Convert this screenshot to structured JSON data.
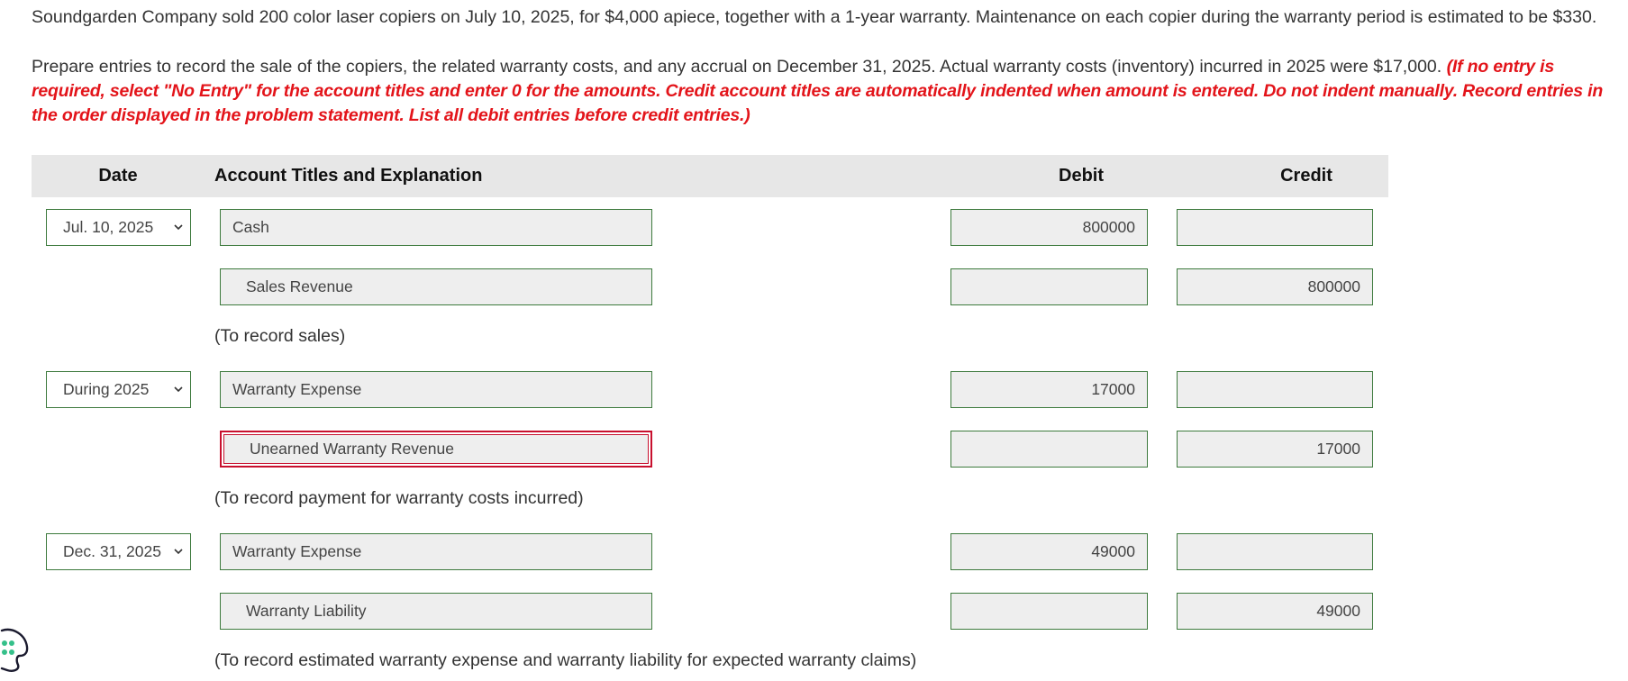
{
  "problem": {
    "paragraph1": "Soundgarden Company sold 200 color laser copiers on July 10, 2025, for $4,000 apiece, together with a 1-year warranty. Maintenance on each copier during the warranty period is estimated to be $330.",
    "paragraph2": "Prepare entries to record the sale of the copiers, the related warranty costs, and any accrual on December 31, 2025. Actual warranty costs (inventory) incurred in 2025 were $17,000.",
    "instructions": "(If no entry is required, select \"No Entry\" for the account titles and enter 0 for the amounts. Credit account titles are automatically indented when amount is entered. Do not indent manually. Record entries in the order displayed in the problem statement. List all debit entries before credit entries.)"
  },
  "table": {
    "headers": {
      "date": "Date",
      "account": "Account Titles and Explanation",
      "debit": "Debit",
      "credit": "Credit"
    }
  },
  "entries": [
    {
      "date": "Jul. 10, 2025",
      "lines": [
        {
          "account": "Cash",
          "debit": "800000",
          "credit": ""
        },
        {
          "account": "Sales Revenue",
          "debit": "",
          "credit": "800000"
        }
      ],
      "explanation": "(To record sales)"
    },
    {
      "date": "During 2025",
      "lines": [
        {
          "account": "Warranty Expense",
          "debit": "17000",
          "credit": ""
        },
        {
          "account": "Unearned Warranty Revenue",
          "debit": "",
          "credit": "17000"
        }
      ],
      "explanation": "(To record payment for warranty costs incurred)"
    },
    {
      "date": "Dec. 31, 2025",
      "lines": [
        {
          "account": "Warranty Expense",
          "debit": "49000",
          "credit": ""
        },
        {
          "account": "Warranty Liability",
          "debit": "",
          "credit": "49000"
        }
      ],
      "explanation": "(To record estimated warranty expense and warranty liability for expected warranty claims)"
    }
  ],
  "colors": {
    "field_border": "#3d7a3d",
    "error_border": "#c8102e",
    "instruction_red": "#e3141a",
    "header_bg": "#e7e7e7"
  },
  "icons": {
    "date_select": "chevron-down-icon",
    "side_widget": "palette-icon"
  }
}
